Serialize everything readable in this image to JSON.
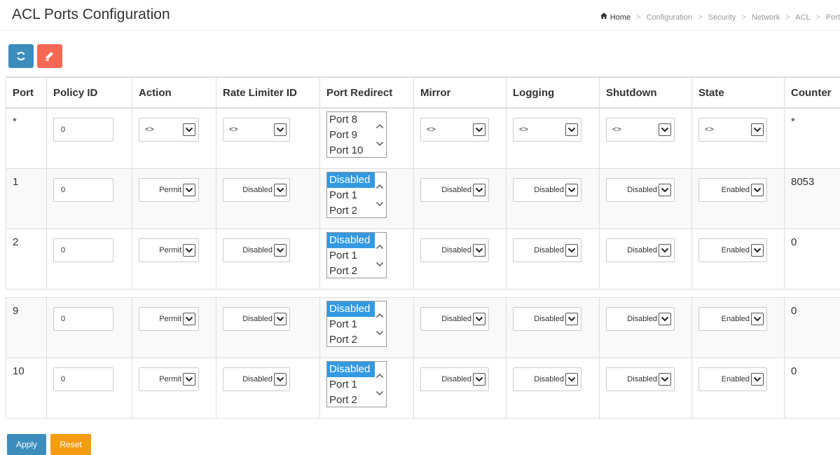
{
  "page": {
    "title": "ACL Ports Configuration",
    "breadcrumb": [
      "Home",
      "Configuration",
      "Security",
      "Network",
      "ACL",
      "Port"
    ],
    "breadcrumb_sep": ">"
  },
  "toolbar": {
    "refresh_icon": "refresh-icon",
    "clear_icon": "eraser-icon"
  },
  "table": {
    "headers": [
      "Port",
      "Policy ID",
      "Action",
      "Rate Limiter ID",
      "Port Redirect",
      "Mirror",
      "Logging",
      "Shutdown",
      "State",
      "Counter"
    ],
    "rows": [
      {
        "port": "*",
        "policy_id": "0",
        "action": "<>",
        "rate_limiter": "<>",
        "redirect": [
          "Port 8",
          "Port 9",
          "Port 10"
        ],
        "redirect_selected": "",
        "mirror": "<>",
        "logging": "<>",
        "shutdown": "<>",
        "state": "<>",
        "counter": "*"
      },
      {
        "port": "1",
        "policy_id": "0",
        "action": "Permit",
        "rate_limiter": "Disabled",
        "redirect": [
          "Disabled",
          "Port 1",
          "Port 2"
        ],
        "redirect_selected": "Disabled",
        "mirror": "Disabled",
        "logging": "Disabled",
        "shutdown": "Disabled",
        "state": "Enabled",
        "counter": "8053"
      },
      {
        "port": "2",
        "policy_id": "0",
        "action": "Permit",
        "rate_limiter": "Disabled",
        "redirect": [
          "Disabled",
          "Port 1",
          "Port 2"
        ],
        "redirect_selected": "Disabled",
        "mirror": "Disabled",
        "logging": "Disabled",
        "shutdown": "Disabled",
        "state": "Enabled",
        "counter": "0"
      },
      {
        "port": "9",
        "policy_id": "0",
        "action": "Permit",
        "rate_limiter": "Disabled",
        "redirect": [
          "Disabled",
          "Port 1",
          "Port 2"
        ],
        "redirect_selected": "Disabled",
        "mirror": "Disabled",
        "logging": "Disabled",
        "shutdown": "Disabled",
        "state": "Enabled",
        "counter": "0"
      },
      {
        "port": "10",
        "policy_id": "0",
        "action": "Permit",
        "rate_limiter": "Disabled",
        "redirect": [
          "Disabled",
          "Port 1",
          "Port 2"
        ],
        "redirect_selected": "Disabled",
        "mirror": "Disabled",
        "logging": "Disabled",
        "shutdown": "Disabled",
        "state": "Enabled",
        "counter": "0"
      }
    ]
  },
  "buttons": {
    "apply": "Apply",
    "reset": "Reset"
  },
  "colors": {
    "primary": "#3c8dbc",
    "danger": "#f56954",
    "warning": "#f39c12",
    "selected": "#3399e0"
  }
}
